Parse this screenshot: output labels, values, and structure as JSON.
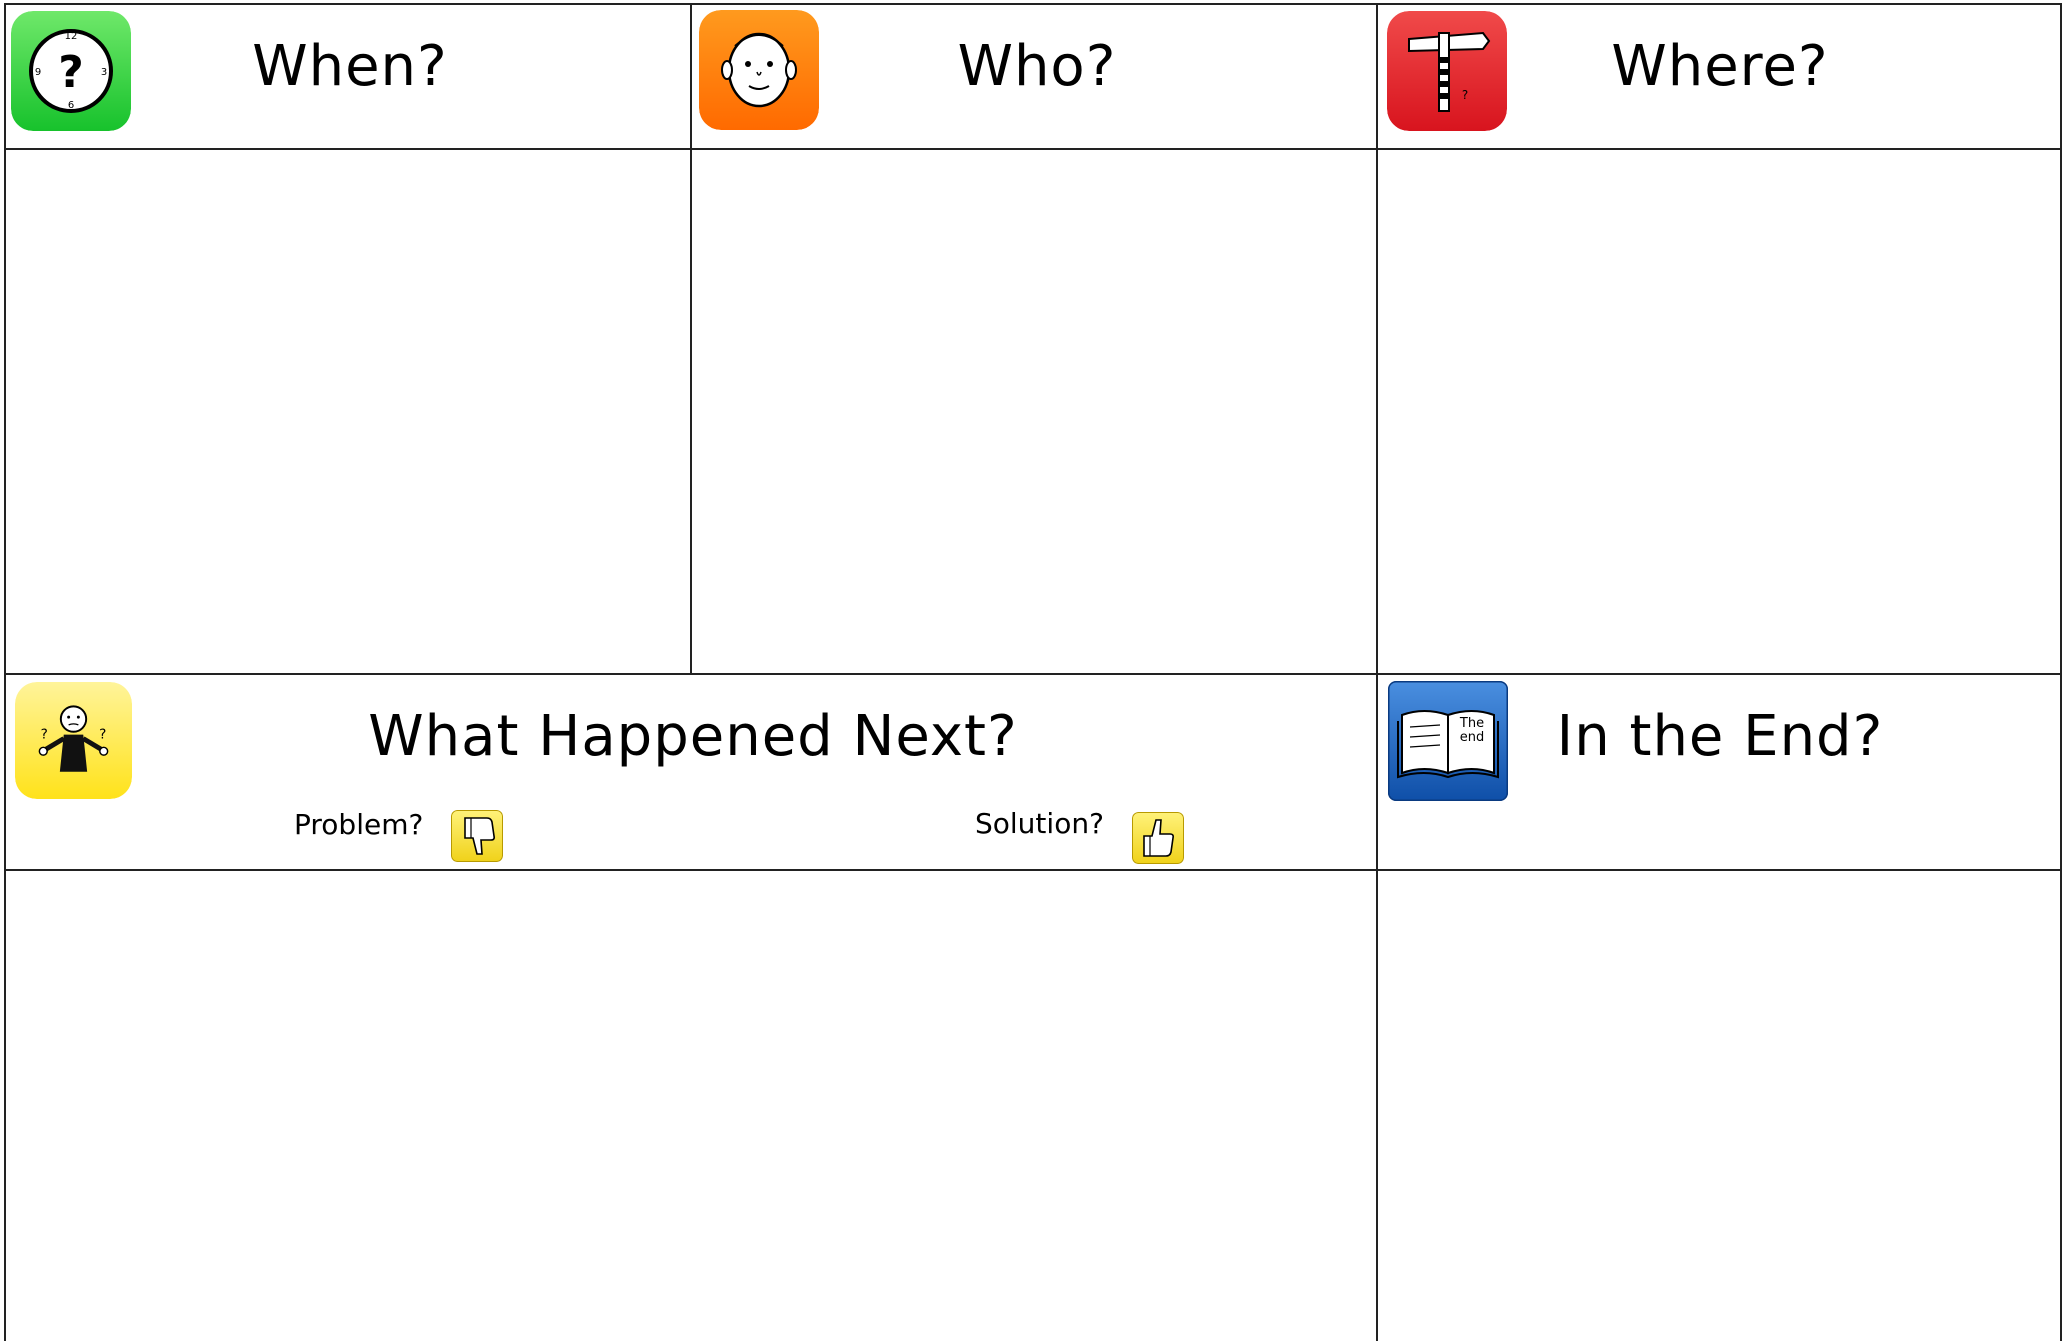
{
  "headings": {
    "when": "When?",
    "who": "Who?",
    "where": "Where?",
    "what_next": "What Happened Next?",
    "in_the_end": "In the End?"
  },
  "subheadings": {
    "problem": "Problem?",
    "solution": "Solution?"
  },
  "icon_text": {
    "book": "The end"
  },
  "colors": {
    "when_icon": "#22cc33",
    "who_icon": "#ff7a00",
    "where_icon": "#e0202a",
    "what_next_icon": "#ffe84a",
    "end_icon": "#1a5fb4",
    "thumb_icon": "#f5df2a"
  },
  "icons": {
    "when": "clock-question-icon",
    "who": "face-icon",
    "where": "signpost-icon",
    "what_next": "confused-person-icon",
    "in_the_end": "open-book-icon",
    "problem": "thumbs-down-icon",
    "solution": "thumbs-up-icon"
  }
}
